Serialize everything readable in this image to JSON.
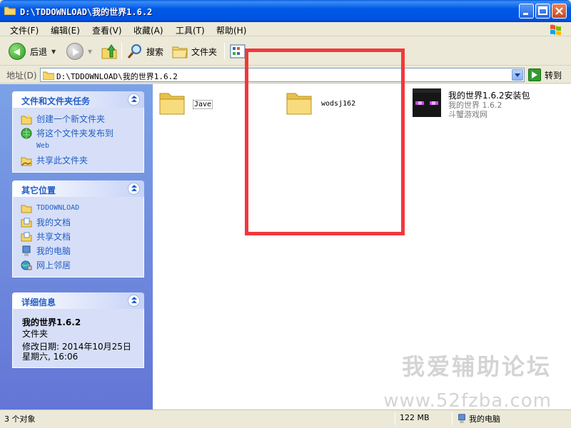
{
  "window": {
    "title": "D:\\TDDOWNLOAD\\我的世界1.6.2"
  },
  "menu": {
    "items": [
      "文件(F)",
      "编辑(E)",
      "查看(V)",
      "收藏(A)",
      "工具(T)",
      "帮助(H)"
    ]
  },
  "toolbar": {
    "back_label": "后退",
    "search_label": "搜索",
    "folders_label": "文件夹"
  },
  "address": {
    "label": "地址(D)",
    "path": "D:\\TDDOWNLOAD\\我的世界1.6.2",
    "go_label": "转到"
  },
  "tasks_panel": {
    "title": "文件和文件夹任务",
    "links": [
      {
        "text": "创建一个新文件夹",
        "icon": "new-folder-icon"
      },
      {
        "text": "将这个文件夹发布到",
        "text2": "Web",
        "icon": "publish-web-icon"
      },
      {
        "text": "共享此文件夹",
        "icon": "share-folder-icon"
      }
    ]
  },
  "places_panel": {
    "title": "其它位置",
    "links": [
      {
        "text": "TDDOWNLOAD",
        "icon": "folder-icon"
      },
      {
        "text": "我的文档",
        "icon": "my-documents-icon"
      },
      {
        "text": "共享文档",
        "icon": "shared-documents-icon"
      },
      {
        "text": "我的电脑",
        "icon": "my-computer-icon"
      },
      {
        "text": "网上邻居",
        "icon": "network-places-icon"
      }
    ]
  },
  "details_panel": {
    "title": "详细信息",
    "name": "我的世界1.6.2",
    "type": "文件夹",
    "modified_line1": "修改日期: 2014年10月25日",
    "modified_line2": "星期六, 16:06"
  },
  "files": [
    {
      "name": "Jave",
      "type": "folder"
    },
    {
      "name": "wodsj162",
      "type": "folder"
    },
    {
      "name": "我的世界1.6.2安装包",
      "line2": "我的世界 1.6.2",
      "line3": "斗蟹游戏网",
      "type": "app"
    }
  ],
  "watermark": {
    "line1": "我爱辅助论坛",
    "line2": "www.52fzba.com"
  },
  "statusbar": {
    "objects": "3 个对象",
    "size": "122 MB",
    "location": "我的电脑"
  },
  "colors": {
    "title_blue": "#0054e3",
    "panel_link": "#215dc6",
    "highlight_red": "#f2383c"
  }
}
